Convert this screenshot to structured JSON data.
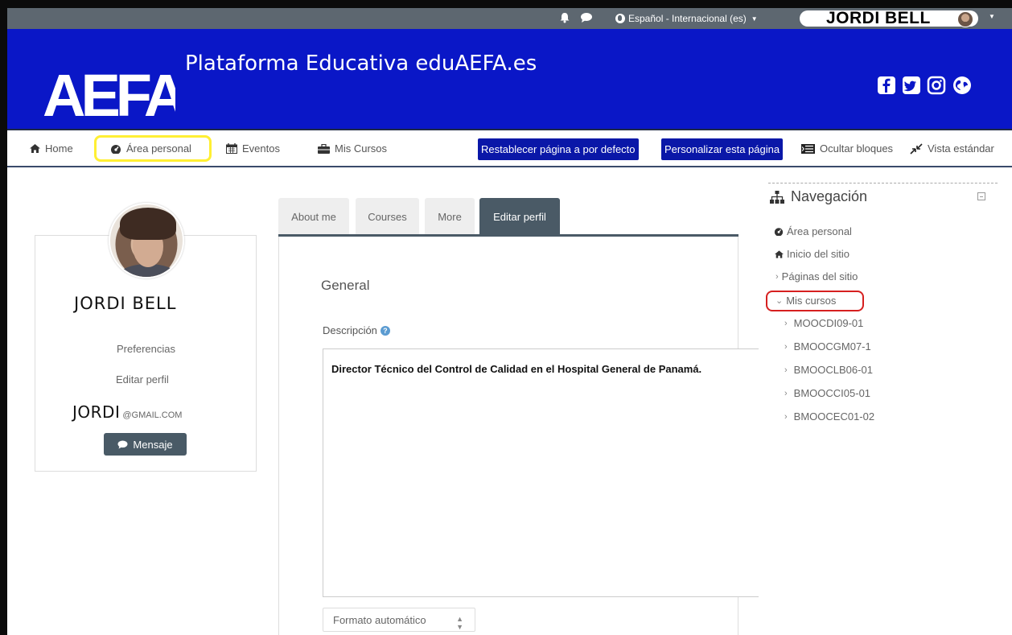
{
  "topbar": {
    "language": "Español - Internacional (es)",
    "user_name": "JORDI BELL",
    "icons": [
      "bell-icon",
      "chat-icon",
      "globe-icon"
    ]
  },
  "header": {
    "logo_text": "AEFA",
    "site_title": "Plataforma Educativa eduAEFA.es",
    "social": [
      "facebook-icon",
      "twitter-icon",
      "instagram-icon",
      "globe-icon"
    ],
    "bg_color": "#0a17c7"
  },
  "navbar": {
    "home": "Home",
    "area_personal": "Área personal",
    "eventos": "Eventos",
    "mis_cursos": "Mis Cursos",
    "reset_btn": "Restablecer página a por defecto",
    "customize_btn": "Personalizar esta página",
    "hide_blocks": "Ocultar bloques",
    "standard_view": "Vista estándar",
    "highlight_color": "#ffef33"
  },
  "profile": {
    "name": "JORDI BELL",
    "preferences": "Preferencias",
    "edit_profile": "Editar perfil",
    "email_user": "JORDI",
    "email_domain": "@GMAIL.COM",
    "message_btn": "Mensaje"
  },
  "tabs": {
    "about": "About me",
    "courses": "Courses",
    "more": "More",
    "edit": "Editar perfil"
  },
  "form": {
    "section": "General",
    "description_label": "Descripción",
    "description": "Director Técnico del Control de Calidad en el Hospital General de Panamá.",
    "format": "Formato automático"
  },
  "nav_block": {
    "title": "Navegación",
    "items": {
      "area_personal": "Área personal",
      "inicio": "Inicio del sitio",
      "paginas": "Páginas del sitio",
      "mis_cursos": "Mis cursos"
    },
    "courses": [
      "MOOCDI09-01",
      "BMOOCGM07-1",
      "BMOOCLB06-01",
      "BMOOCCI05-01",
      "BMOOCEC01-02"
    ],
    "highlight_color": "#d62020"
  }
}
